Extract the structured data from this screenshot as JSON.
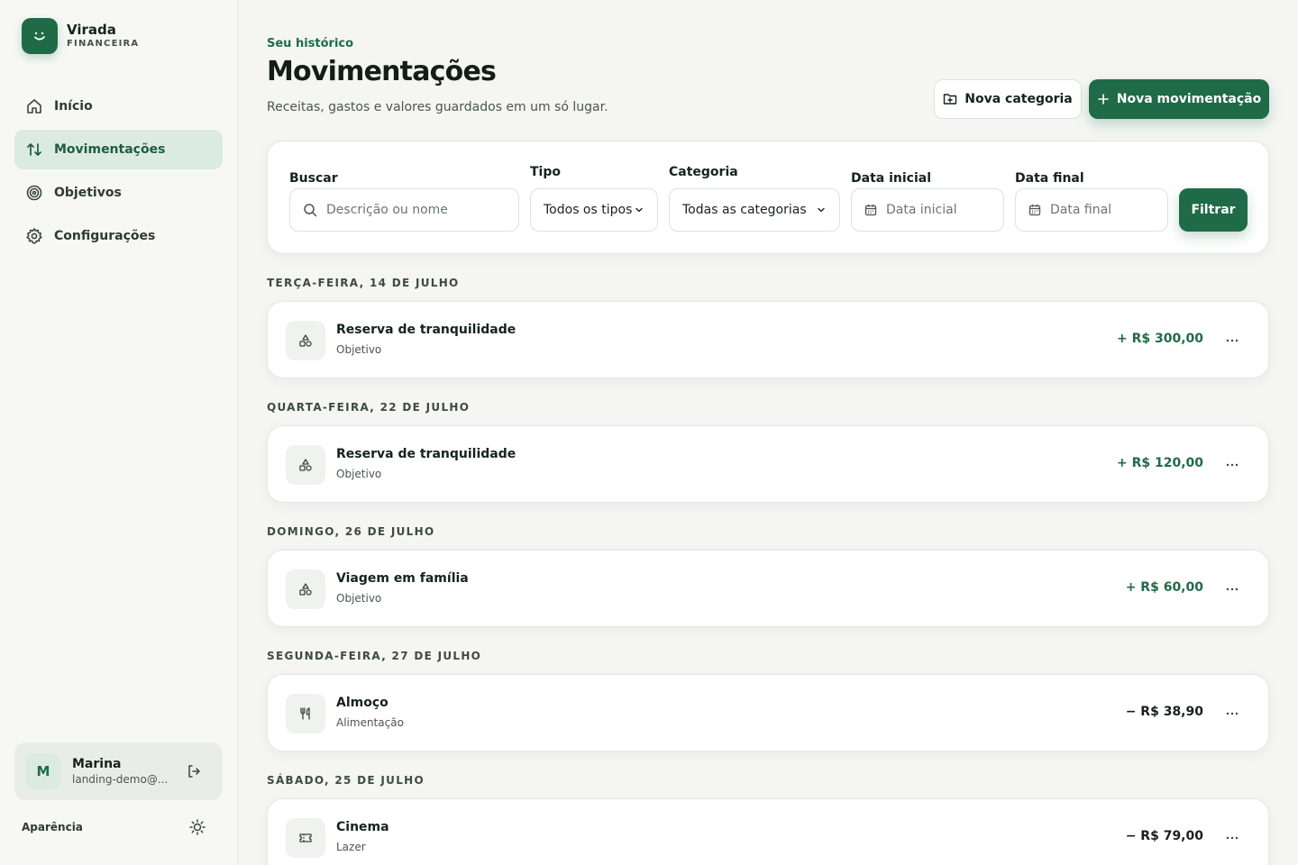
{
  "brand": {
    "name": "Virada",
    "subtitle": "FINANCEIRA",
    "logo_icon": "smile-face-icon"
  },
  "nav": {
    "items": [
      {
        "label": "Início",
        "icon": "home-icon",
        "active": false
      },
      {
        "label": "Movimentações",
        "icon": "arrows-up-down-icon",
        "active": true
      },
      {
        "label": "Objetivos",
        "icon": "target-icon",
        "active": false
      },
      {
        "label": "Configurações",
        "icon": "gear-icon",
        "active": false
      }
    ]
  },
  "user": {
    "initial": "M",
    "name": "Marina",
    "email": "landing-demo@..."
  },
  "appearance": {
    "label": "Aparência"
  },
  "header": {
    "eyebrow": "Seu histórico",
    "title": "Movimentações",
    "subtitle": "Receitas, gastos e valores guardados em um só lugar.",
    "new_category": "Nova categoria",
    "new_transaction": "Nova movimentação"
  },
  "filters": {
    "search_label": "Buscar",
    "search_placeholder": "Descrição ou nome",
    "type_label": "Tipo",
    "type_value": "Todos os tipos",
    "category_label": "Categoria",
    "category_value": "Todas as categorias",
    "start_label": "Data inicial",
    "start_placeholder": "Data inicial",
    "end_label": "Data final",
    "end_placeholder": "Data final",
    "submit": "Filtrar"
  },
  "groups": [
    {
      "date": "Terça-feira, 14 de julho",
      "tx": {
        "title": "Reserva de tranquilidade",
        "category": "Objetivo",
        "amount": "+ R$ 300,00",
        "kind": "pos",
        "icon": "shapes-icon"
      }
    },
    {
      "date": "Quarta-feira, 22 de julho",
      "tx": {
        "title": "Reserva de tranquilidade",
        "category": "Objetivo",
        "amount": "+ R$ 120,00",
        "kind": "pos",
        "icon": "shapes-icon"
      }
    },
    {
      "date": "Domingo, 26 de julho",
      "tx": {
        "title": "Viagem em família",
        "category": "Objetivo",
        "amount": "+ R$ 60,00",
        "kind": "pos",
        "icon": "shapes-icon"
      }
    },
    {
      "date": "Segunda-feira, 27 de julho",
      "tx": {
        "title": "Almoço",
        "category": "Alimentação",
        "amount": "− R$ 38,90",
        "kind": "neg",
        "icon": "utensils-icon"
      }
    },
    {
      "date": "Sábado, 25 de julho",
      "tx": {
        "title": "Cinema",
        "category": "Lazer",
        "amount": "− R$ 79,00",
        "kind": "neg",
        "icon": "ticket-icon"
      }
    }
  ],
  "colors": {
    "accent": "#1f6b47",
    "accent_soft": "#dcebe1",
    "background": "#f5f6f4"
  }
}
